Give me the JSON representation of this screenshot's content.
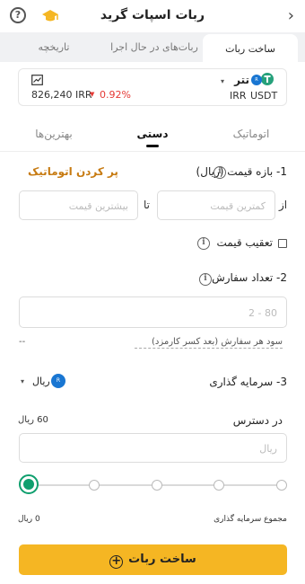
{
  "header": {
    "title": "ربات اسپات گرید",
    "back_icon": "chevron-right-icon",
    "help_symbol": "?",
    "hat_icon": "graduation-cap-icon"
  },
  "tabs": [
    {
      "label": "ساخت ربات",
      "active": true
    },
    {
      "label": "ربات‌های در حال اجرا",
      "active": false
    },
    {
      "label": "تاریخچه",
      "active": false
    }
  ],
  "market": {
    "name": "تتر",
    "pair_base": "USDT",
    "pair_quote": "IRR",
    "price": "826,240 IRR",
    "change": "0.92%",
    "change_color": "#e53935",
    "chart_icon": "chart-icon"
  },
  "mode_tabs": [
    {
      "label": "اتوماتیک",
      "active": false
    },
    {
      "label": "دستی",
      "active": true
    },
    {
      "label": "بهترین‌ها",
      "active": false
    }
  ],
  "price_range": {
    "title": "1- بازه قیمت (ریال)",
    "autofill_label": "پر کردن اتوماتیک",
    "autofill_color": "#c77b12",
    "from_label": "از",
    "to_label": "تا",
    "min_placeholder": "کمترین قیمت",
    "max_placeholder": "بیشترین قیمت"
  },
  "trailing": {
    "label": "تعقیب قیمت",
    "checked": false
  },
  "order_count": {
    "title": "2- تعداد سفارش",
    "placeholder": "80 - 2",
    "profit_label": "سود هر سفارش (بعد کسر کارمزد)",
    "profit_value": "--"
  },
  "investment": {
    "title": "3- سرمایه گذاری",
    "currency": "ریال",
    "available_label": "در دسترس",
    "available_value": "60 ریال",
    "amount_placeholder": "ریال",
    "total_label": "مجموع سرمایه گذاری",
    "total_value": "0 ریال",
    "slider_percent": 0
  },
  "submit": {
    "label": "ساخت ربات"
  },
  "colors": {
    "accent": "#f5b623",
    "green": "#0f9f6e",
    "tether": "#26a17b",
    "rial_badge": "#1976d2"
  }
}
